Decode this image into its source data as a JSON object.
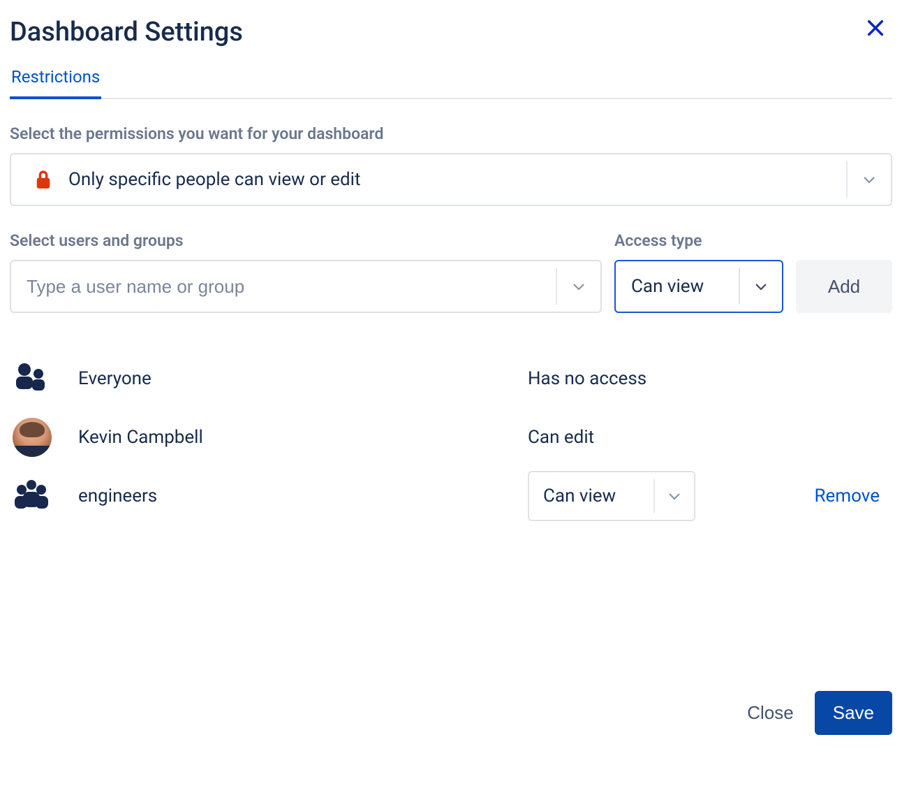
{
  "header": {
    "title": "Dashboard Settings"
  },
  "tabs": {
    "restrictions": "Restrictions"
  },
  "permission_selector": {
    "label": "Select the permissions you want for your dashboard",
    "value": "Only specific people can view or edit"
  },
  "user_picker": {
    "label": "Select users and groups",
    "placeholder": "Type a user name or group"
  },
  "access_type": {
    "label": "Access type",
    "value": "Can view"
  },
  "buttons": {
    "add": "Add",
    "close": "Close",
    "save": "Save",
    "remove": "Remove"
  },
  "entries": [
    {
      "kind": "group-everyone",
      "name": "Everyone",
      "access_text": "Has no access",
      "editable": false,
      "removable": false
    },
    {
      "kind": "user",
      "name": "Kevin Campbell",
      "access_text": "Can edit",
      "editable": false,
      "removable": false
    },
    {
      "kind": "group",
      "name": "engineers",
      "access_text": "Can view",
      "editable": true,
      "removable": true
    }
  ],
  "colors": {
    "primary": "#0052CC",
    "saveBtn": "#0747A6",
    "lock": "#DE350B",
    "text": "#172B4D",
    "muted": "#6B778C"
  }
}
